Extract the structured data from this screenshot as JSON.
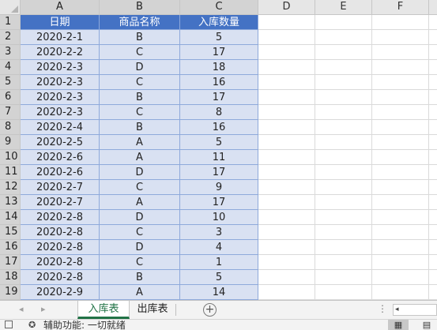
{
  "columns": [
    "A",
    "B",
    "C",
    "D",
    "E",
    "F"
  ],
  "row_numbers": [
    "1",
    "2",
    "3",
    "4",
    "5",
    "6",
    "7",
    "8",
    "9",
    "10",
    "11",
    "12",
    "13",
    "14",
    "15",
    "16",
    "17",
    "18",
    "19"
  ],
  "table": {
    "headers": [
      "日期",
      "商品名称",
      "入库数量"
    ],
    "rows": [
      [
        "2020-2-1",
        "B",
        "5"
      ],
      [
        "2020-2-2",
        "C",
        "17"
      ],
      [
        "2020-2-3",
        "D",
        "18"
      ],
      [
        "2020-2-3",
        "C",
        "16"
      ],
      [
        "2020-2-3",
        "B",
        "17"
      ],
      [
        "2020-2-3",
        "C",
        "8"
      ],
      [
        "2020-2-4",
        "B",
        "16"
      ],
      [
        "2020-2-5",
        "A",
        "5"
      ],
      [
        "2020-2-6",
        "A",
        "11"
      ],
      [
        "2020-2-6",
        "D",
        "17"
      ],
      [
        "2020-2-7",
        "C",
        "9"
      ],
      [
        "2020-2-7",
        "A",
        "17"
      ],
      [
        "2020-2-8",
        "D",
        "10"
      ],
      [
        "2020-2-8",
        "C",
        "3"
      ],
      [
        "2020-2-8",
        "D",
        "4"
      ],
      [
        "2020-2-8",
        "C",
        "1"
      ],
      [
        "2020-2-8",
        "B",
        "5"
      ],
      [
        "2020-2-9",
        "A",
        "14"
      ]
    ]
  },
  "sheet_tabs": [
    {
      "label": "入库表",
      "active": true
    },
    {
      "label": "出库表",
      "active": false
    }
  ],
  "icons": {
    "add_sheet": "plus-circle-icon",
    "nav_prev": "triangle-left-icon",
    "nav_next": "triangle-right-icon",
    "more": "vertical-dots-icon",
    "accessibility": "accessibility-icon",
    "view": "grid-view-icon"
  },
  "status": {
    "text": "辅助功能: 一切就绪"
  },
  "colors": {
    "header_fill": "#4472c4",
    "data_fill": "#d9e1f2",
    "accent": "#217346"
  }
}
